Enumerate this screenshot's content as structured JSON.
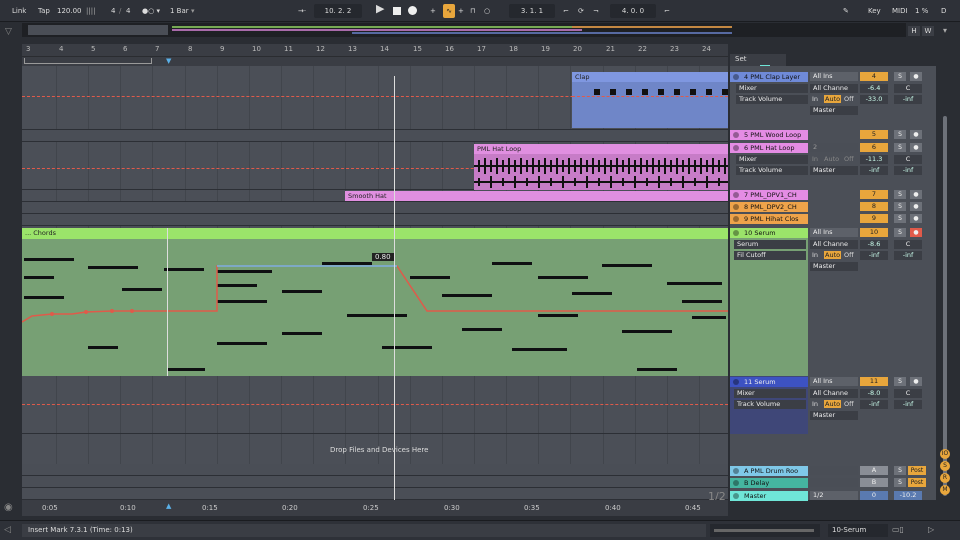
{
  "topbar": {
    "link": "Link",
    "tap": "Tap",
    "tempo": "120.00",
    "signature_num": "4",
    "signature_den": "4",
    "quantize": "1 Bar",
    "position": "10. 2. 2",
    "loop_start": "3. 1. 1",
    "loop_length": "4. 0. 0",
    "key_label": "Key",
    "midi_label": "MIDI",
    "cpu": "1 %",
    "d_label": "D"
  },
  "overview": {
    "h_label": "H",
    "w_label": "W"
  },
  "ruler": {
    "bars": [
      "3",
      "4",
      "5",
      "6",
      "7",
      "8",
      "9",
      "10",
      "11",
      "12",
      "13",
      "14",
      "15",
      "16",
      "17",
      "18",
      "19",
      "20",
      "21",
      "22",
      "23",
      "24"
    ]
  },
  "set_label": "Set",
  "clips": {
    "clap": "Clap",
    "hat_loop": "PML Hat Loop",
    "smooth_hat": "Smooth Hat",
    "chords": "... Chords",
    "automation_value": "0.80",
    "drop_text": "Drop Files and Devices Here"
  },
  "tracks": [
    {
      "name": "4 PML Clap Layer",
      "number": "4",
      "io": "All Ins",
      "color": "#6f8ad8"
    },
    {
      "name": "5 PML Wood Loop",
      "number": "5",
      "color": "#e48ce4"
    },
    {
      "name": "6 PML Hat Loop",
      "number": "6",
      "io": "2",
      "color": "#e48ce4"
    },
    {
      "name": "7 PML_DPV1_CH",
      "number": "7",
      "color": "#e48ce4"
    },
    {
      "name": "8 PML_DPV2_CH",
      "number": "8",
      "color": "#eea34a"
    },
    {
      "name": "9 PML Hihat Clos",
      "number": "9",
      "color": "#eea34a"
    },
    {
      "name": "10 Serum",
      "number": "10",
      "io": "All Ins",
      "color": "#9be46a"
    },
    {
      "name": "11 Serum",
      "number": "11",
      "io": "All Ins",
      "color": "#3d52c2"
    },
    {
      "name": "A PML Drum Roo",
      "number": "A",
      "send": "Post",
      "color": "#7fc8e8"
    },
    {
      "name": "B Delay",
      "number": "B",
      "send": "Post",
      "color": "#45b5a0"
    },
    {
      "name": "Master",
      "number": "0",
      "io": "1/2",
      "color": "#6fe6d8"
    }
  ],
  "mixer": {
    "mixer_label": "Mixer",
    "track_volume": "Track Volume",
    "all_channels": "All Channe",
    "master": "Master",
    "in_label": "In",
    "auto_label": "Auto",
    "off_label": "Off",
    "c_label": "C",
    "inf": "-inf",
    "serum_label": "Serum",
    "filter_cutoff": "Fil Cutoff",
    "vol_4": "-6.4",
    "vol_4b": "-33.0",
    "vol_6": "-11.3",
    "vol_10": "-8.6",
    "vol_11": "-8.0",
    "vol_master": "-10.2",
    "s": "S",
    "post": "Post"
  },
  "timeruler": {
    "times": [
      "0:05",
      "0:10",
      "0:15",
      "0:20",
      "0:25",
      "0:30",
      "0:35",
      "0:40",
      "0:45"
    ],
    "page": "1/2"
  },
  "status": {
    "message": "Insert Mark 7.3.1 (Time: 0:13)",
    "device": "10-Serum"
  }
}
